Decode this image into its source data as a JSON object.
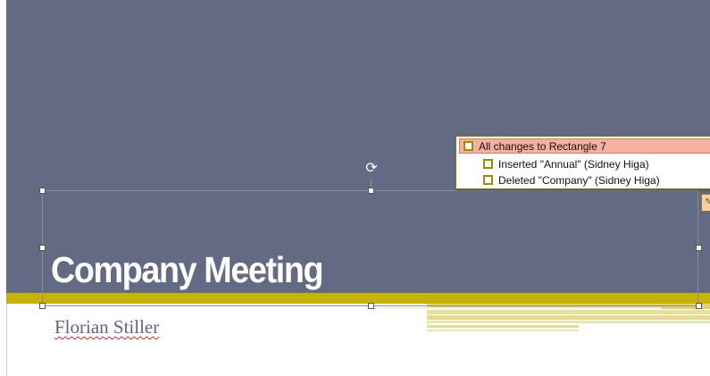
{
  "slide": {
    "title": "Company Meeting",
    "subtitle": "Florian Stiller",
    "colors": {
      "background": "#636a84",
      "accent_bar": "#c9b302",
      "title_text": "#ffffff",
      "subtitle_text": "#5e6487"
    }
  },
  "selection": {
    "rotate_icon": "rotate-icon"
  },
  "revision_panel": {
    "header": "All changes to Rectangle 7",
    "items": [
      {
        "label": "Inserted \"Annual\" (Sidney Higa)"
      },
      {
        "label": "Deleted \"Company\" (Sidney Higa)"
      }
    ],
    "colors": {
      "header_bg": "#f4b19f",
      "checkbox_border": "#9c8e00"
    }
  },
  "change_marker": {
    "icon": "edit-marker-icon"
  }
}
